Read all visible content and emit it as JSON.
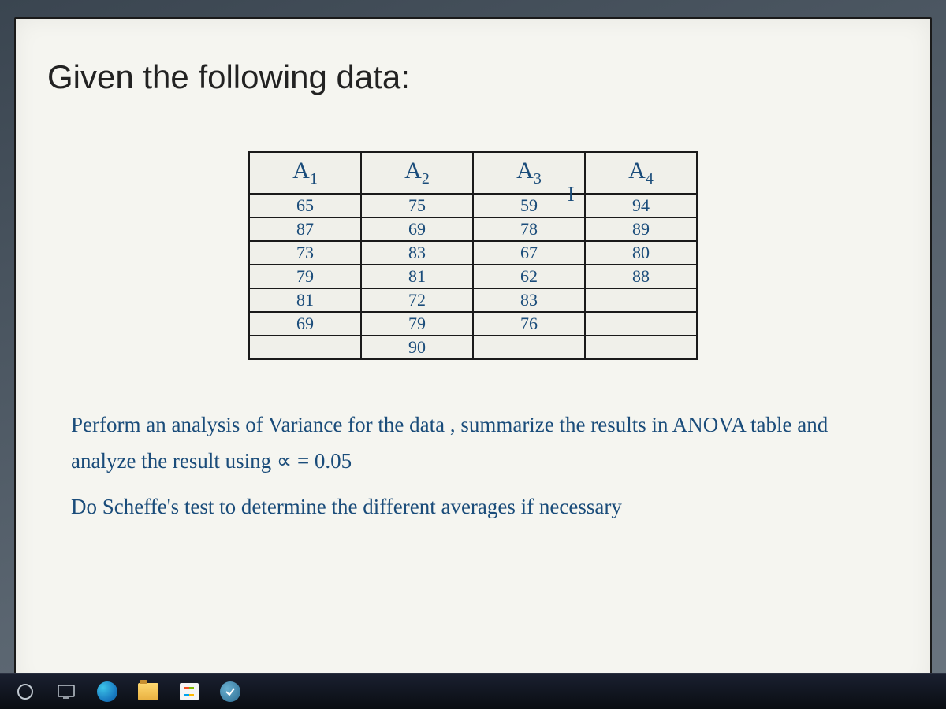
{
  "heading": "Given the following data:",
  "chart_data": {
    "type": "table",
    "headers": [
      {
        "base": "A",
        "sub": "1"
      },
      {
        "base": "A",
        "sub": "2"
      },
      {
        "base": "A",
        "sub": "3"
      },
      {
        "base": "A",
        "sub": "4"
      }
    ],
    "columns": {
      "A1": [
        65,
        87,
        73,
        79,
        81,
        69
      ],
      "A2": [
        75,
        69,
        83,
        81,
        72,
        79,
        90
      ],
      "A3": [
        59,
        78,
        67,
        62,
        83,
        76
      ],
      "A4": [
        94,
        89,
        80,
        88
      ]
    },
    "rows": [
      [
        "65",
        "75",
        "59",
        "94"
      ],
      [
        "87",
        "69",
        "78",
        "89"
      ],
      [
        "73",
        "83",
        "67",
        "80"
      ],
      [
        "79",
        "81",
        "62",
        "88"
      ],
      [
        "81",
        "72",
        "83",
        ""
      ],
      [
        "69",
        "79",
        "76",
        ""
      ],
      [
        "",
        "90",
        "",
        ""
      ]
    ]
  },
  "paragraph1": "Perform an analysis of Variance for the data , summarize the results in ANOVA table and analyze the result using ∝ = 0.05",
  "paragraph2": "Do Scheffe's test to determine the different averages if necessary",
  "cursor_text": "I",
  "taskbar": {
    "start": "start-button",
    "taskview": "task-view",
    "edge": "microsoft-edge",
    "explorer": "file-explorer",
    "store": "microsoft-store",
    "app": "pinned-app"
  }
}
